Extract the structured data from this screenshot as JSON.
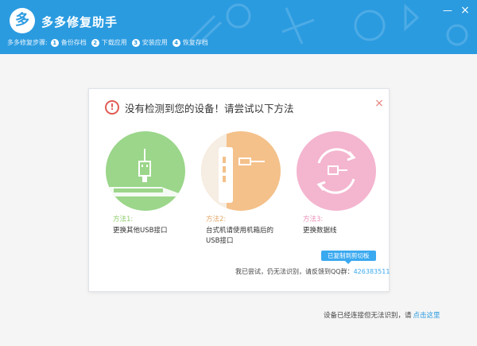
{
  "app": {
    "logo_text": "多",
    "title": "多多修复助手",
    "window_min": "—",
    "window_close": "×"
  },
  "steps": {
    "lead": "多多修复步骤:",
    "items": [
      {
        "num": "1",
        "label": "备份存档"
      },
      {
        "num": "2",
        "label": "下载应用"
      },
      {
        "num": "3",
        "label": "安装应用"
      },
      {
        "num": "4",
        "label": "恢复存档"
      }
    ]
  },
  "dialog": {
    "alert_glyph": "!",
    "title": "没有检测到您的设备！请尝试以下方法",
    "close": "×",
    "methods": [
      {
        "label": "方法1:",
        "text": "更换其他USB接口"
      },
      {
        "label": "方法2:",
        "text": "台式机请使用机箱后的",
        "text2": "USB接口"
      },
      {
        "label": "方法3:",
        "text": "更换数据线"
      }
    ],
    "copy_badge": "已复制到剪切板",
    "feedback_text": "我已尝试，仍无法识别，请反馈到QQ群：",
    "qq_group": "426383511"
  },
  "footer": {
    "text": "设备已经连接但无法识别，请",
    "link": "点击这里"
  },
  "colors": {
    "header_blue": "#2b9be0",
    "green": "#9bd68a",
    "orange": "#f4c18a",
    "pink": "#f4b5cf",
    "link_blue": "#3aa9f0",
    "alert_red": "#e05a54"
  }
}
